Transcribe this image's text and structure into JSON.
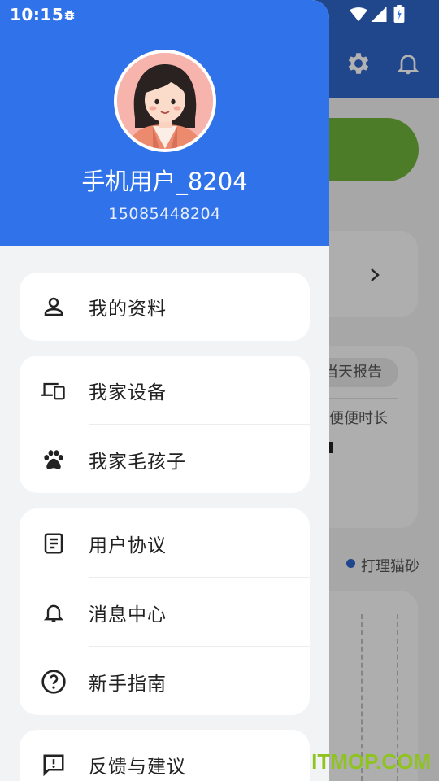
{
  "status_bar": {
    "time": "10:15"
  },
  "profile": {
    "username": "手机用户_8204",
    "phone": "15085448204"
  },
  "menu": {
    "my_profile": {
      "label": "我的资料",
      "icon": "person-icon"
    },
    "my_devices": {
      "label": "我家设备",
      "icon": "devices-icon"
    },
    "my_pets": {
      "label": "我家毛孩子",
      "icon": "paw-icon"
    },
    "user_agreement": {
      "label": "用户协议",
      "icon": "document-icon"
    },
    "message_center": {
      "label": "消息中心",
      "icon": "bell-icon"
    },
    "beginner_guide": {
      "label": "新手指南",
      "icon": "help-circle-icon"
    },
    "feedback": {
      "label": "反馈与建议",
      "icon": "feedback-icon"
    }
  },
  "background": {
    "today_report_chip": "当天报告",
    "stat_label": "便便时长",
    "legend_label": "打理猫砂"
  },
  "watermark": "ITMOP.COM",
  "colors": {
    "header_blue": "#2F72EA",
    "appbar_blue": "#2F66C9",
    "green_button": "#6FB23C"
  }
}
